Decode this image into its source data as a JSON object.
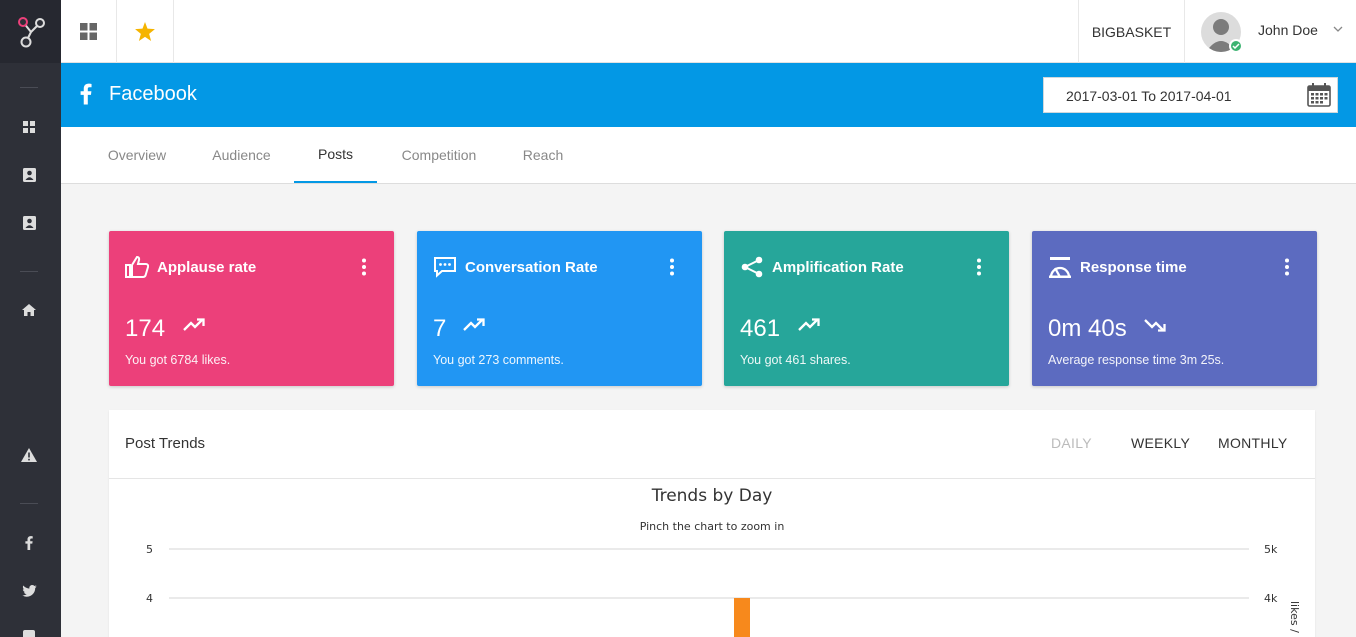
{
  "app": {
    "company": "BIGBASKET",
    "user": {
      "name": "John Doe"
    }
  },
  "page": {
    "title": "Facebook",
    "date_range": "2017-03-01 To 2017-04-01"
  },
  "tabs": [
    {
      "label": "Overview",
      "active": false
    },
    {
      "label": "Audience",
      "active": false
    },
    {
      "label": "Posts",
      "active": true
    },
    {
      "label": "Competition",
      "active": false
    },
    {
      "label": "Reach",
      "active": false
    }
  ],
  "cards": [
    {
      "title": "Applause rate",
      "value": "174",
      "trend": "up",
      "subtitle": "You got 6784 likes.",
      "color": "#ec407a",
      "icon": "thumbs-up-icon"
    },
    {
      "title": "Conversation Rate",
      "value": "7",
      "trend": "up",
      "subtitle": "You got 273 comments.",
      "color": "#2196f3",
      "icon": "comment-icon"
    },
    {
      "title": "Amplification Rate",
      "value": "461",
      "trend": "up",
      "subtitle": "You got 461 shares.",
      "color": "#26a69a",
      "icon": "share-icon"
    },
    {
      "title": "Response time",
      "value": "0m 40s",
      "trend": "down",
      "subtitle": "Average response time 3m 25s.",
      "color": "#5c6bc0",
      "icon": "timer-icon"
    }
  ],
  "post_trends": {
    "title": "Post Trends",
    "periods": [
      {
        "label": "DAILY",
        "active": false
      },
      {
        "label": "WEEKLY",
        "active": true
      },
      {
        "label": "MONTHLY",
        "active": true
      }
    ]
  },
  "chart_data": {
    "type": "bar",
    "title": "Trends by Day",
    "subtitle": "Pinch the chart to zoom in",
    "y_left_ticks": [
      "5",
      "4"
    ],
    "y_right_ticks": [
      "5k",
      "4k"
    ],
    "y_right_label": "likes /",
    "ylim": [
      0,
      5
    ],
    "series": [
      {
        "values": [
          4
        ],
        "color": "#f7891c"
      }
    ],
    "grid": true
  }
}
